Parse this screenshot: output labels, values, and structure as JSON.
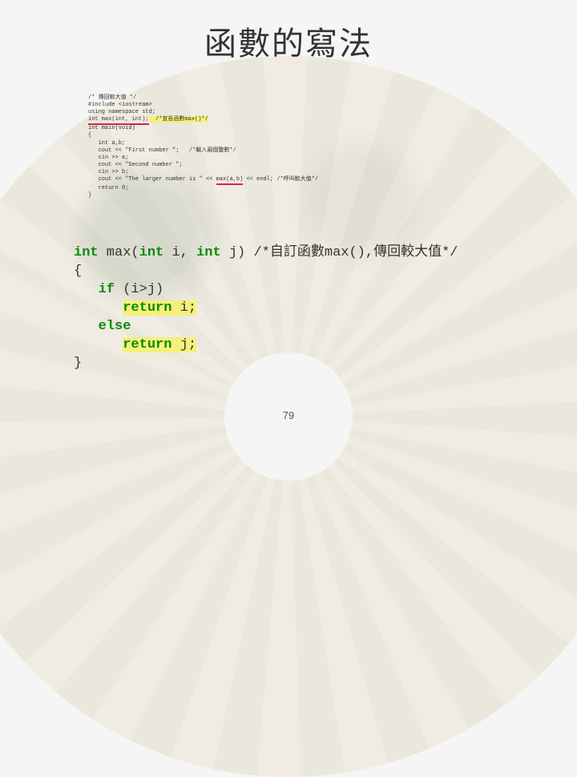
{
  "title": "函數的寫法",
  "code_small": {
    "c1": "/* 傳回較大值 */",
    "c2": "#include <iostream>",
    "c3": "using namespace std;",
    "c4_a": "int max(int, int);",
    "c4_b": "  /*宣告函數max()*/",
    "c5": "int main(void)",
    "c6": "{",
    "c7": "   int a,b;",
    "c8": "   cout << \"First number \";   /*輸入兩個整數*/",
    "c9": "   cin >> a;",
    "c10": "   cout << \"Second number \";",
    "c11": "   cin >> b;",
    "c12_a": "   cout << \"The larger number is \" << ",
    "c12_b": "max(a,b)",
    "c12_c": " << endl; /*呼叫較大值*/",
    "c13": "   return 0;",
    "c14": "}"
  },
  "code_big": {
    "l1_a": "int",
    "l1_b": " max(",
    "l1_c": "int",
    "l1_d": " i, ",
    "l1_e": "int",
    "l1_f": " j) ",
    "l1_comment": "/*自訂函數max(),傳回較大值*/",
    "l2": "{",
    "l3_a": "   ",
    "l3_b": "if",
    "l3_c": " (i>j)",
    "l4_a": "      ",
    "l4_b": "return",
    "l4_c": " i;",
    "l5_a": "   ",
    "l5_b": "else",
    "l6_a": "      ",
    "l6_b": "return",
    "l6_c": " j;",
    "l7": "}"
  },
  "page_number": "79",
  "chart_data": {
    "type": "table",
    "title": "函數的寫法",
    "description": "C++ code slide illustrating how to declare, call, and define a custom max() function that returns the larger of two integers.",
    "snippets": [
      {
        "role": "program",
        "language": "C++",
        "code": "/* 傳回較大值 */\n#include <iostream>\nusing namespace std;\nint max(int, int);  /*宣告函數max()*/\nint main(void)\n{\n   int a,b;\n   cout << \"First number \";   /*輸入兩個整數*/\n   cin >> a;\n   cout << \"Second number \";\n   cin >> b;\n   cout << \"The larger number is \" << max(a,b) << endl; /*呼叫較大值*/\n   return 0;\n}"
      },
      {
        "role": "function_definition_enlarged",
        "language": "C++",
        "code": "int max(int i, int j) /*自訂函數max(),傳回較大值*/\n{\n   if (i>j)\n      return i;\n   else\n      return j;\n}"
      }
    ],
    "highlights": [
      "int max(int, int);  /*宣告函數max()*/",
      "max(a,b)",
      "return i;",
      "return j;"
    ]
  }
}
